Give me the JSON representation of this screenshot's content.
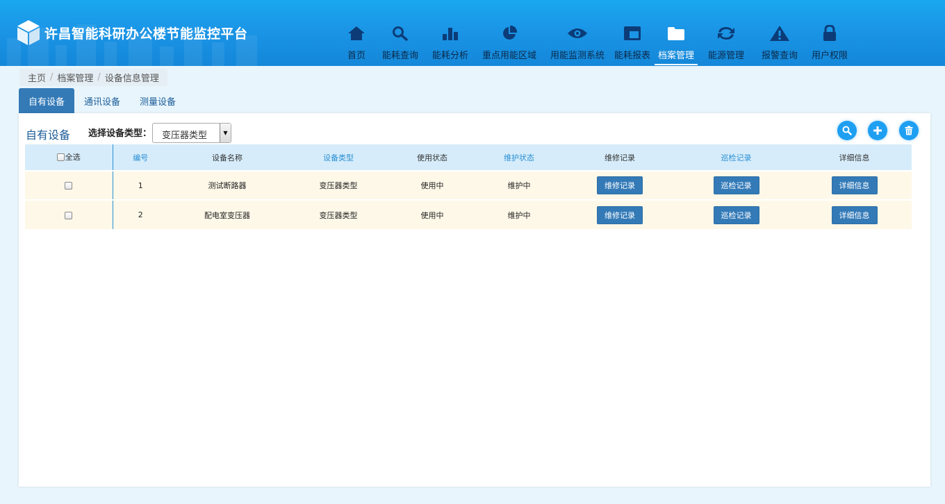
{
  "app": {
    "title": "许昌智能科研办公楼节能监控平台"
  },
  "nav": [
    {
      "label": "首页",
      "icon": "home-icon"
    },
    {
      "label": "能耗查询",
      "icon": "search-icon"
    },
    {
      "label": "能耗分析",
      "icon": "bar-chart-icon"
    },
    {
      "label": "重点用能区域",
      "icon": "pie-chart-icon"
    },
    {
      "label": "用能监测系统",
      "icon": "eye-icon"
    },
    {
      "label": "能耗报表",
      "icon": "table-icon"
    },
    {
      "label": "档案管理",
      "icon": "folder-icon",
      "active": true
    },
    {
      "label": "能源管理",
      "icon": "refresh-icon"
    },
    {
      "label": "报警查询",
      "icon": "warning-icon"
    },
    {
      "label": "用户权限",
      "icon": "lock-icon"
    }
  ],
  "breadcrumb": [
    "主页",
    "档案管理",
    "设备信息管理"
  ],
  "tabs": [
    {
      "label": "自有设备",
      "active": true
    },
    {
      "label": "通讯设备"
    },
    {
      "label": "测量设备"
    }
  ],
  "panel": {
    "title": "自有设备",
    "filter_label": "选择设备类型：",
    "filter_value": "变压器类型"
  },
  "table": {
    "select_all": "全选",
    "headers": [
      "编号",
      "设备名称",
      "设备类型",
      "使用状态",
      "维护状态",
      "维修记录",
      "巡检记录",
      "详细信息"
    ],
    "rows": [
      {
        "id": "1",
        "name": "测试断路器",
        "type": "变压器类型",
        "use_status": "使用中",
        "maint_status": "维护中",
        "repair": "维修记录",
        "inspect": "巡检记录",
        "detail": "详细信息"
      },
      {
        "id": "2",
        "name": "配电室变压器",
        "type": "变压器类型",
        "use_status": "使用中",
        "maint_status": "维护中",
        "repair": "维修记录",
        "inspect": "巡检记录",
        "detail": "详细信息"
      }
    ]
  },
  "colors": {
    "header": "#1b95e6",
    "accent": "#337ab7",
    "row_bg": "#fdf8e8",
    "header_row_bg": "#d6ecfa",
    "page_bg": "#e8f5fc"
  }
}
